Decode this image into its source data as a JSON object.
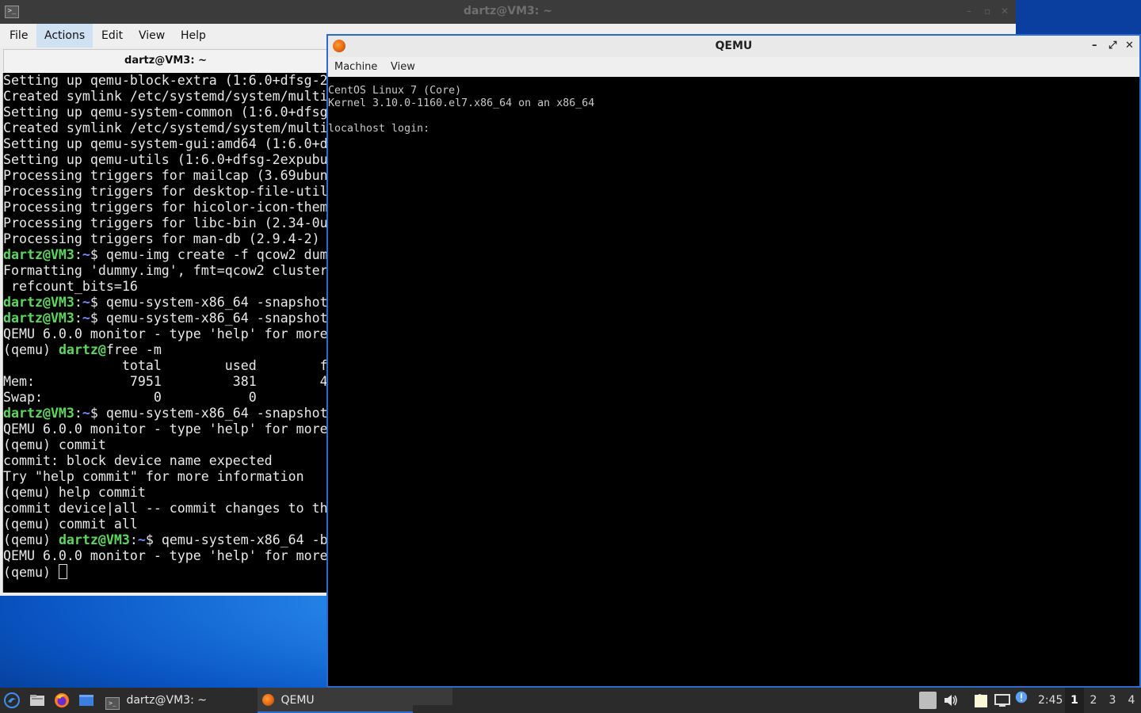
{
  "terminal": {
    "window_title": "dartz@VM3: ~",
    "window_controls": [
      "–",
      "▫",
      "✕"
    ],
    "menu": [
      "File",
      "Actions",
      "Edit",
      "View",
      "Help"
    ],
    "active_menu_index": 1,
    "tab_title": "dartz@VM3: ~",
    "lines": [
      [
        {
          "t": "Setting up qemu-block-extra (1:6.0+dfsg-2"
        }
      ],
      [
        {
          "t": "Created symlink /etc/systemd/system/multi"
        }
      ],
      [
        {
          "t": "Setting up qemu-system-common (1:6.0+dfsg"
        }
      ],
      [
        {
          "t": "Created symlink /etc/systemd/system/multi"
        }
      ],
      [
        {
          "t": "Setting up qemu-system-gui:amd64 (1:6.0+d"
        }
      ],
      [
        {
          "t": "Setting up qemu-utils (1:6.0+dfsg-2expubu"
        }
      ],
      [
        {
          "t": "Processing triggers for mailcap (3.69ubun"
        }
      ],
      [
        {
          "t": "Processing triggers for desktop-file-util"
        }
      ],
      [
        {
          "t": "Processing triggers for hicolor-icon-them"
        }
      ],
      [
        {
          "t": "Processing triggers for libc-bin (2.34-0u"
        }
      ],
      [
        {
          "t": "Processing triggers for man-db (2.9.4-2)"
        }
      ],
      [
        {
          "t": "dartz@VM3",
          "c": "g"
        },
        {
          "t": ":"
        },
        {
          "t": "~",
          "c": "b"
        },
        {
          "t": "$ qemu-img create -f qcow2 dum"
        }
      ],
      [
        {
          "t": "Formatting 'dummy.img', fmt=qcow2 cluster"
        }
      ],
      [
        {
          "t": " refcount_bits=16"
        }
      ],
      [
        {
          "t": "dartz@VM3",
          "c": "g"
        },
        {
          "t": ":"
        },
        {
          "t": "~",
          "c": "b"
        },
        {
          "t": "$ qemu-system-x86_64 -snapshot"
        }
      ],
      [
        {
          "t": "dartz@VM3",
          "c": "g"
        },
        {
          "t": ":"
        },
        {
          "t": "~",
          "c": "b"
        },
        {
          "t": "$ qemu-system-x86_64 -snapshot"
        }
      ],
      [
        {
          "t": "QEMU 6.0.0 monitor - type 'help' for more"
        }
      ],
      [
        {
          "t": "(qemu) "
        },
        {
          "t": "dartz@",
          "c": "g"
        },
        {
          "t": "free -m"
        }
      ],
      [
        {
          "t": "               total        used        f"
        }
      ],
      [
        {
          "t": "Mem:            7951         381        4"
        }
      ],
      [
        {
          "t": "Swap:              0           0"
        }
      ],
      [
        {
          "t": "dartz@VM3",
          "c": "g"
        },
        {
          "t": ":"
        },
        {
          "t": "~",
          "c": "b"
        },
        {
          "t": "$ qemu-system-x86_64 -snapshot"
        }
      ],
      [
        {
          "t": "QEMU 6.0.0 monitor - type 'help' for more"
        }
      ],
      [
        {
          "t": "(qemu) commit"
        }
      ],
      [
        {
          "t": "commit: block device name expected"
        }
      ],
      [
        {
          "t": "Try \"help commit\" for more information"
        }
      ],
      [
        {
          "t": "(qemu) help commit"
        }
      ],
      [
        {
          "t": "commit device|all -- commit changes to th"
        }
      ],
      [
        {
          "t": "(qemu) commit all"
        }
      ],
      [
        {
          "t": "(qemu) "
        },
        {
          "t": "dartz@VM3",
          "c": "g"
        },
        {
          "t": ":"
        },
        {
          "t": "~",
          "c": "b"
        },
        {
          "t": "$ qemu-system-x86_64 -b"
        }
      ],
      [
        {
          "t": "QEMU 6.0.0 monitor - type 'help' for more"
        }
      ],
      [
        {
          "t": "(qemu) "
        },
        {
          "cursor": true
        }
      ]
    ]
  },
  "qemu": {
    "window_title": "QEMU",
    "window_controls": [
      "–",
      "⤢",
      "✕"
    ],
    "menu": [
      "Machine",
      "View"
    ],
    "screen_lines": [
      "",
      "CentOS Linux 7 (Core)",
      "Kernel 3.10.0-1160.el7.x86_64 on an x86_64",
      "",
      "localhost login:"
    ]
  },
  "taskbar": {
    "tasks": [
      {
        "label": "dartz@VM3: ~",
        "icon": "terminal-icon"
      },
      {
        "label": "QEMU",
        "icon": "qemu-icon"
      }
    ],
    "active_task_index": 1,
    "clock": "2:45",
    "workspaces": [
      "1",
      "2",
      "3",
      "4"
    ],
    "active_workspace_index": 0,
    "colors": {
      "accent": "#2e6cd1",
      "bg": "#2b2b2b"
    }
  }
}
